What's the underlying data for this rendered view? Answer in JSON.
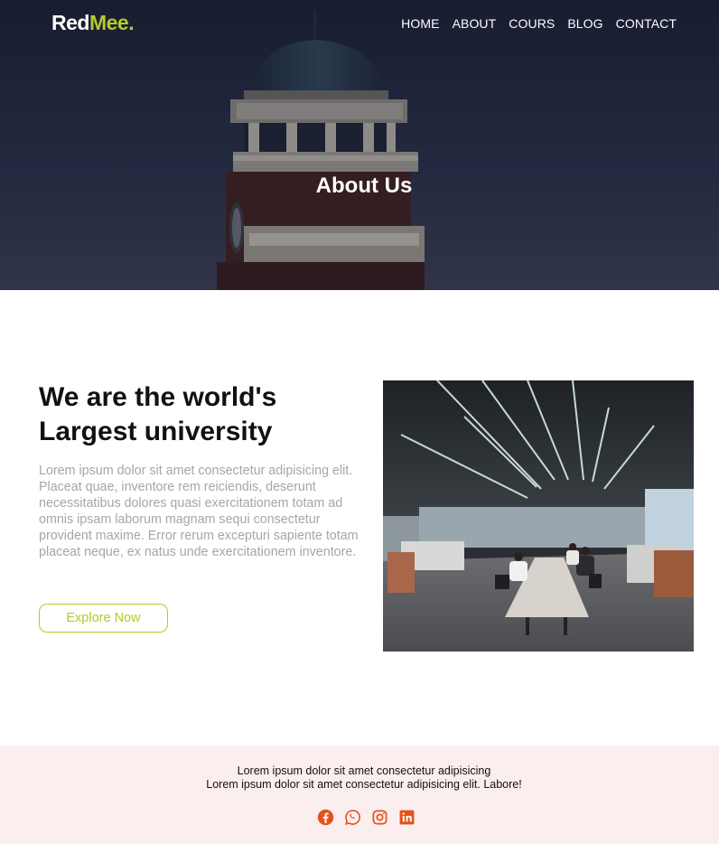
{
  "brand": {
    "part1": "Red",
    "part2": "Mee.",
    "accent_color": "#b5c92a"
  },
  "nav": {
    "items": [
      "HOME",
      "ABOUT",
      "COURS",
      "BLOG",
      "CONTACT"
    ]
  },
  "hero": {
    "title": "About Us"
  },
  "about": {
    "heading_line1": "We are the world's",
    "heading_line2": "Largest university",
    "body": "Lorem ipsum dolor sit amet consectetur adipisicing elit. Placeat quae, inventore rem reiciendis, deserunt necessitatibus dolores quasi exercitationem totam ad omnis ipsam laborum magnam sequi consectetur provident maxime. Error rerum excepturi sapiente totam placeat neque, ex natus unde exercitationem inventore.",
    "button": "Explore Now"
  },
  "footer": {
    "line1": "Lorem ipsum dolor sit amet consectetur adipisicing",
    "line2": "Lorem ipsum dolor sit amet consectetur adipisicing elit. Labore!",
    "icon_color": "#e2531b",
    "social_icons": [
      "facebook-icon",
      "whatsapp-icon",
      "instagram-icon",
      "linkedin-icon"
    ]
  }
}
